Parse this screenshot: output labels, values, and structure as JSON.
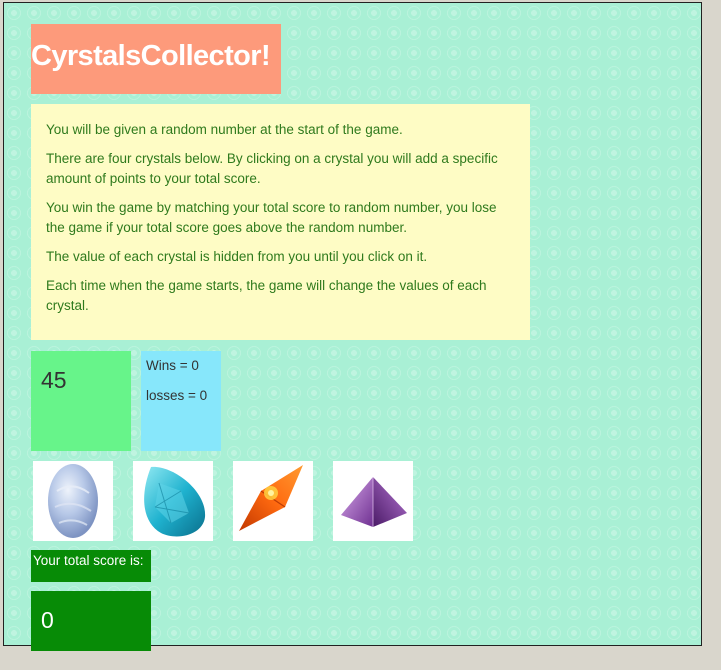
{
  "game": {
    "title": "CyrstalsCollector!",
    "instructions": [
      "You will be given a random number at the start of the game.",
      "There are four crystals below. By clicking on a crystal you will add a specific amount of points to your total score.",
      "You win the game by matching your total score to random number, you lose the game if your total score goes above the random number.",
      "The value of each crystal is hidden from you until you click on it.",
      "Each time when the game starts, the game will change the values of each crystal."
    ],
    "random_number": "45",
    "wins_text": "Wins = 0",
    "losses_text": "losses = 0",
    "score_label": "Your total score is:",
    "total_score": "0"
  },
  "crystals": [
    {
      "icon": "blue-lace-agate-crystal-icon"
    },
    {
      "icon": "aqua-teardrop-crystal-icon"
    },
    {
      "icon": "orange-diamond-crystal-icon"
    },
    {
      "icon": "amethyst-pyramid-crystal-icon"
    }
  ],
  "colors": {
    "page_background": "#a9f0d5",
    "title_background": "#fd9a7b",
    "instructions_background": "#fefcc5",
    "instructions_text": "#2f7a1d",
    "random_box": "#67f48a",
    "stats_box": "#87e7fb",
    "score_box": "#078b06"
  }
}
